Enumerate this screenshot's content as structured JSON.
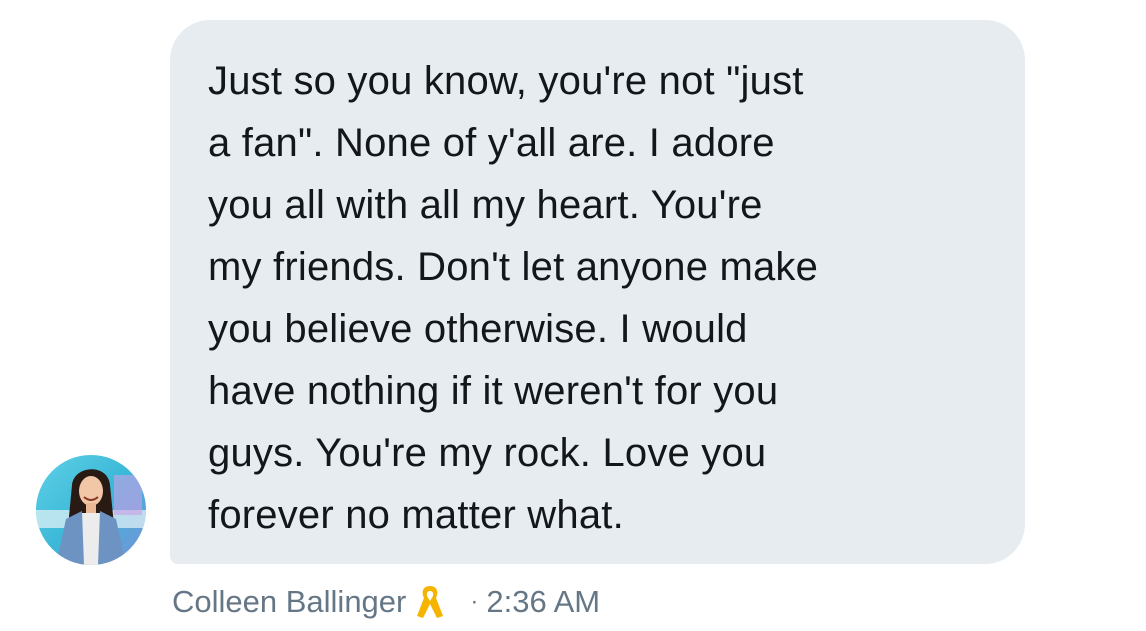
{
  "message": {
    "text": "Just so you know, you're not \"just\na fan\". None of y'all are. I adore\nyou all with all my heart. You're\nmy friends. Don't let anyone make\nyou believe otherwise. I would\nhave nothing if it weren't for you\nguys. You're my rock. Love you\nforever no matter what."
  },
  "sender": {
    "name": "Colleen Ballinger",
    "badge_icon": "yellow-ribbon-icon",
    "separator": "·",
    "time": "2:36 AM"
  },
  "colors": {
    "bubble_bg": "#e6ecf0",
    "text": "#14171a",
    "meta_text": "#657786",
    "ribbon": "#f5b400"
  }
}
